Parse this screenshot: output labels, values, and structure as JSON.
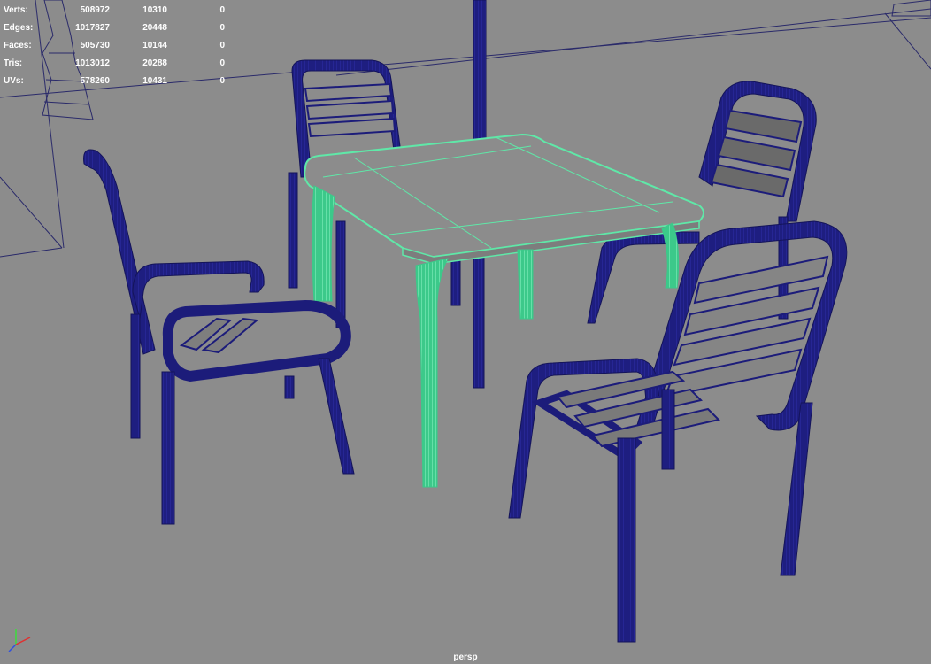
{
  "hud": {
    "rows": [
      {
        "label": "Verts:",
        "v1": "508972",
        "v2": "10310",
        "v3": "0"
      },
      {
        "label": "Edges:",
        "v1": "1017827",
        "v2": "20448",
        "v3": "0"
      },
      {
        "label": "Faces:",
        "v1": "505730",
        "v2": "10144",
        "v3": "0"
      },
      {
        "label": "Tris:",
        "v1": "1013012",
        "v2": "20288",
        "v3": "0"
      },
      {
        "label": "UVs:",
        "v1": "578260",
        "v2": "10431",
        "v3": "0"
      }
    ]
  },
  "viewport": {
    "camera_label": "persp"
  },
  "colors": {
    "background": "#8c8c8c",
    "wireframe": "#1c1c7a",
    "selected": "#5fe8a8",
    "ghost": "#2a2a6a"
  },
  "icons": {
    "axis": "xyz-axis-icon"
  }
}
